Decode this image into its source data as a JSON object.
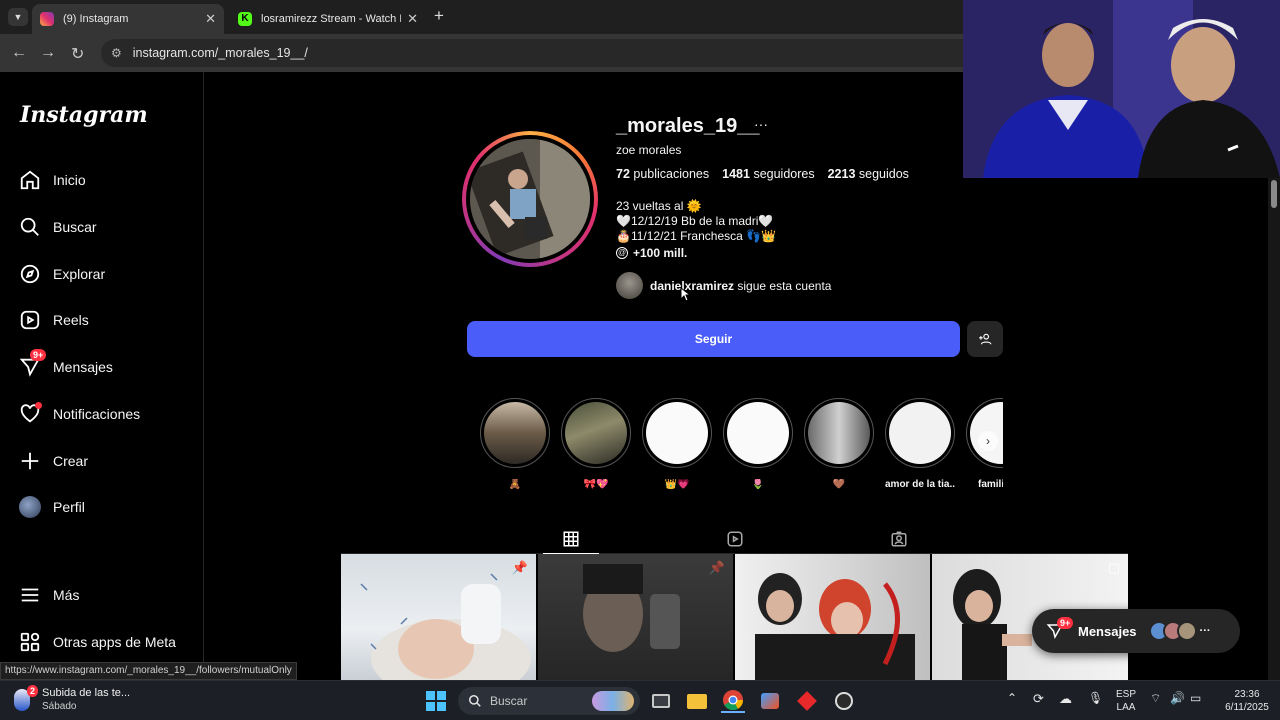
{
  "browser": {
    "tabs": [
      {
        "title": "(9) Instagram",
        "active": true,
        "favicon_color": "#e1306c"
      },
      {
        "title": "losramirezz Stream - Watch Live",
        "active": false,
        "favicon_color": "#53fc18"
      }
    ],
    "url": "instagram.com/_morales_19__/",
    "status_url": "https://www.instagram.com/_morales_19__/followers/mutualOnly"
  },
  "sidebar": {
    "logo": "Instagram",
    "items": [
      {
        "label": "Inicio",
        "icon": "home-icon"
      },
      {
        "label": "Buscar",
        "icon": "search-icon"
      },
      {
        "label": "Explorar",
        "icon": "compass-icon"
      },
      {
        "label": "Reels",
        "icon": "reels-icon"
      },
      {
        "label": "Mensajes",
        "icon": "messenger-icon",
        "badge": "9+"
      },
      {
        "label": "Notificaciones",
        "icon": "heart-icon"
      },
      {
        "label": "Crear",
        "icon": "plus-icon"
      },
      {
        "label": "Perfil",
        "icon": "profile-avatar-icon"
      },
      {
        "label": "Más",
        "icon": "menu-icon"
      },
      {
        "label": "Otras apps de Meta",
        "icon": "meta-apps-icon"
      }
    ]
  },
  "profile": {
    "username": "_morales_19__",
    "more": "···",
    "full_name": "zoe morales",
    "posts_count": "72",
    "posts_label": "publicaciones",
    "followers_count": "1481",
    "followers_label": "seguidores",
    "following_count": "2213",
    "following_label": "seguidos",
    "bio": [
      "23 vueltas al 🌞",
      "🤍12/12/19 Bb de la madri🤍",
      "🎂11/12/21 Franchesca 👣👑",
      "+100 mill."
    ],
    "followed_by_user": "danielxramirez",
    "followed_by_text": " sigue esta cuenta",
    "follow_button": "Seguir"
  },
  "highlights": [
    {
      "label": "🧸"
    },
    {
      "label": "🎀💖"
    },
    {
      "label": "👑💗"
    },
    {
      "label": "🌷"
    },
    {
      "label": "🤎"
    },
    {
      "label": "amor de la tia..."
    },
    {
      "label": "famili"
    }
  ],
  "post_tabs": [
    "posts-grid",
    "reels",
    "tagged"
  ],
  "floating_messages": {
    "label": "Mensajes",
    "badge": "9+"
  },
  "taskbar": {
    "notification_title": "Subida de las te...",
    "notification_sub": "Sábado",
    "notification_badge": "2",
    "search_placeholder": "Buscar",
    "lang_top": "ESP",
    "lang_bottom": "LAA",
    "time": "23:36",
    "date": "6/11/2025"
  },
  "colors": {
    "follow_button": "#4a5df9",
    "badge": "#ff3040"
  }
}
